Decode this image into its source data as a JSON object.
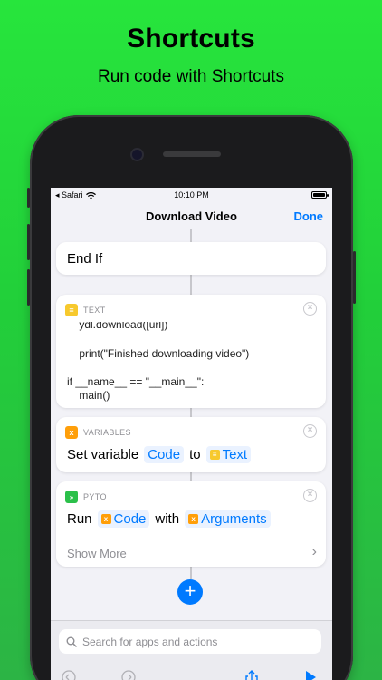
{
  "promo": {
    "title": "Shortcuts",
    "subtitle": "Run code with Shortcuts"
  },
  "status_bar": {
    "carrier": "Safari",
    "time": "10:10 PM"
  },
  "nav": {
    "title": "Download Video",
    "done_label": "Done"
  },
  "end_if": {
    "label": "End If"
  },
  "text_action": {
    "category": "TEXT",
    "close_glyph": "×",
    "code_lines": [
      "    ydl.download([url])",
      "",
      "    print(\"Finished downloading video\")",
      "",
      "if __name__ == \"__main__\":",
      "    main()"
    ]
  },
  "variables_action": {
    "category": "VARIABLES",
    "close_glyph": "×",
    "set_label": "Set variable",
    "variable_token": "Code",
    "to_label": "to",
    "value_token": "Text"
  },
  "pyto_action": {
    "category": "PYTO",
    "close_glyph": "×",
    "run_label": "Run",
    "code_token": "Code",
    "with_label": "with",
    "args_token": "Arguments",
    "show_more_label": "Show More"
  },
  "add_button_glyph": "+",
  "search": {
    "placeholder": "Search for apps and actions"
  },
  "colors": {
    "background_green": "#27e53c",
    "accent_blue": "#007aff",
    "text_icon_yellow": "#f7c92d",
    "variables_icon_orange": "#ff9f0a",
    "pyto_icon_green": "#2bc04a"
  },
  "icons": {
    "wifi": "wifi-icon",
    "battery": "battery-icon",
    "text_category": "text-lines-icon",
    "variables_category": "variable-x-icon",
    "pyto_category": "pyto-chevrons-icon",
    "search": "search-icon",
    "chevron": "chevron-right-icon"
  }
}
